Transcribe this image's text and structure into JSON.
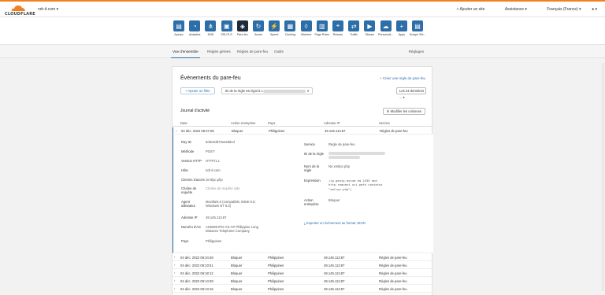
{
  "brand": {
    "logo_text": "CLOUDFLARE",
    "accent": "#f38020",
    "nav_blue": "#2d6ea8"
  },
  "top": {
    "domain": "ndr-it.com",
    "add_site": "+ Ajouter un site",
    "support": "Assistance",
    "language": "Français (France)"
  },
  "nav": [
    {
      "label": "Aperçu",
      "icon": "overview-icon",
      "glyph": "▤"
    },
    {
      "label": "Analytics",
      "icon": "analytics-icon",
      "glyph": "◔"
    },
    {
      "label": "DNS",
      "icon": "dns-icon",
      "glyph": "⋔"
    },
    {
      "label": "SSL/TLS",
      "icon": "lock-icon",
      "glyph": "▣"
    },
    {
      "label": "Pare-feu",
      "icon": "firewall-icon",
      "glyph": "◈"
    },
    {
      "label": "Accès",
      "icon": "access-icon",
      "glyph": "↻"
    },
    {
      "label": "Speed",
      "icon": "speed-icon",
      "glyph": "⚡"
    },
    {
      "label": "Caching",
      "icon": "caching-icon",
      "glyph": "▦"
    },
    {
      "label": "Workers",
      "icon": "workers-icon",
      "glyph": "◊"
    },
    {
      "label": "Page Rules",
      "icon": "page-rules-icon",
      "glyph": "▥"
    },
    {
      "label": "Réseau",
      "icon": "network-icon",
      "glyph": "⌖"
    },
    {
      "label": "Traffic",
      "icon": "traffic-icon",
      "glyph": "⇄"
    },
    {
      "label": "Stream",
      "icon": "stream-icon",
      "glyph": "▶"
    },
    {
      "label": "Personnal...",
      "icon": "custom-icon",
      "glyph": "☁"
    },
    {
      "label": "Apps",
      "icon": "apps-icon",
      "glyph": "+"
    },
    {
      "label": "Scrape Shi...",
      "icon": "scrape-shield-icon",
      "glyph": "▤"
    }
  ],
  "subnav": {
    "tabs": [
      "Vue d'ensemble",
      "Règles gérées",
      "Règles de pare-feu",
      "Outils"
    ],
    "settings": "Réglages"
  },
  "panel": {
    "title": "Événements du pare-feu",
    "create_rule": "+ Créer une règle de pare-feu",
    "add_filter": "+ Ajouter un filtre",
    "chip_text": "ID de la règle est égal à c",
    "range": "Les 24 dernières ...",
    "log_title": "Journal d'activité",
    "columns_button": "Modifier les colonnes"
  },
  "table": {
    "headers": [
      "Date",
      "Action entreprise",
      "Pays",
      "Adresse IP",
      "Service"
    ],
    "rows": [
      {
        "date": "04 déc. 2022 06:27:06",
        "action": "Bloquer",
        "country": "Philippines",
        "ip": "49.145.113.87",
        "service": "Règles de pare-feu"
      },
      {
        "date": "04 déc. 2022 06:24:48",
        "action": "Bloquer",
        "country": "Philippines",
        "ip": "49.145.113.87",
        "service": "Règles de pare-feu"
      },
      {
        "date": "04 déc. 2022 06:23:51",
        "action": "Bloquer",
        "country": "Philippines",
        "ip": "49.145.113.87",
        "service": "Règles de pare-feu"
      },
      {
        "date": "04 déc. 2022 06:18:12",
        "action": "Bloquer",
        "country": "Philippines",
        "ip": "49.145.113.87",
        "service": "Règles de pare-feu"
      },
      {
        "date": "04 déc. 2022 06:14:28",
        "action": "Bloquer",
        "country": "Philippines",
        "ip": "49.145.113.87",
        "service": "Règles de pare-feu"
      },
      {
        "date": "04 déc. 2022 06:13:16",
        "action": "Bloquer",
        "country": "Philippines",
        "ip": "49.145.113.87",
        "service": "Règles de pare-feu"
      }
    ]
  },
  "detail": {
    "ray_id_label": "Ray ID",
    "ray_id": "5d3c0dd73ee6ddcd",
    "method_label": "Méthode",
    "method": "POST",
    "http_label": "Version HTTP",
    "http": "HTTP/1.1",
    "host_label": "Hôte",
    "host": "ndr-it.com",
    "path_label": "Chemin d'accès",
    "path": "/xmlrpc.php",
    "query_label": "Chaîne de requête",
    "query": "Chaîne de requête vide",
    "agent_label": "Agent utilisateur",
    "agent": "Mozilla/4.0 (compatible; MSIE 6.0; Windows NT 5.0)",
    "ip_label": "Adresse IP",
    "ip": "49.145.113.87",
    "as_label": "Numéro d'AS",
    "as": "AS9299 IPG-AS-AP Philippine Long Distance Telephone Company",
    "country_label": "Pays",
    "country": "Philippines",
    "service_label": "Service",
    "service": "Règle de pare-feu",
    "rule_id_label": "ID de la règle",
    "rule_name_label": "Nom de la règle",
    "rule_name": "No xmlrpc.php",
    "expression_label": "Expression",
    "expression": "(ip.geoip.asnum eq 2435 and http.request.uri.path contains \"xmlrpc.php\")",
    "action_label": "Action entreprise",
    "action": "Bloquer",
    "export": "Exporter un événement au format JSON"
  }
}
